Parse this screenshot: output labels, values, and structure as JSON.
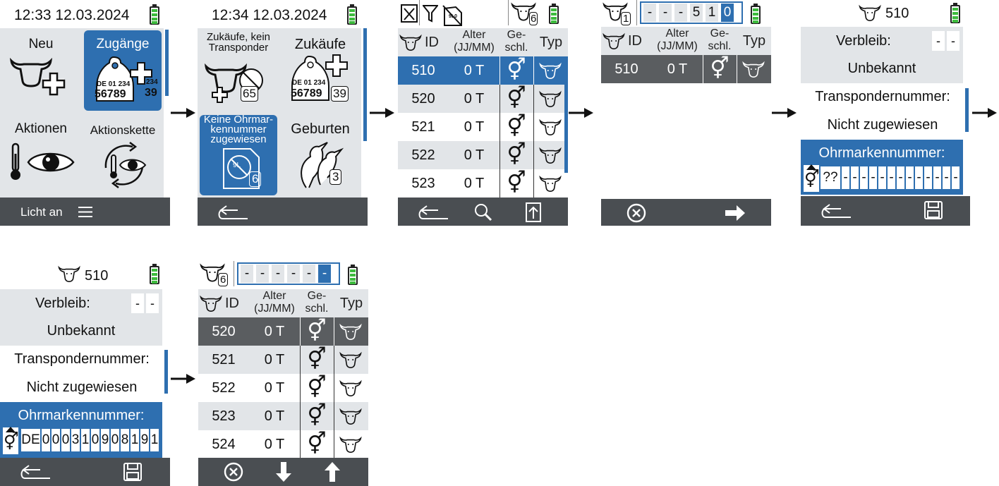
{
  "s1": {
    "datetime": "12:33 12.03.2024",
    "tiles": [
      {
        "label": "Neu",
        "icon": "cow-plus-icon"
      },
      {
        "label": "Zugänge",
        "icon": "eartag-plus-icon",
        "tag_line1": "DE 01 234",
        "tag_line2": "56789",
        "tag_side1": "234",
        "tag_side2": "39"
      },
      {
        "label": "Aktionen",
        "icon": "thermometer-eye-icon"
      },
      {
        "label": "Aktionskette",
        "icon": "action-cycle-icon"
      }
    ],
    "footer": {
      "label": "Licht an",
      "menu_icon": "hamburger-menu-icon"
    }
  },
  "s2": {
    "datetime": "12:34 12.03.2024",
    "tiles": [
      {
        "label": "Zukäufe, kein Transponder",
        "badge": "65"
      },
      {
        "label": "Zukäufe",
        "tag_line1": "DE 01 234",
        "tag_line2": "56789",
        "badge": "39"
      },
      {
        "label": "Keine Ohrmar-kennummer zugewiesen",
        "badge": "6",
        "tag_text": "9L"
      },
      {
        "label": "Geburten",
        "badge": "3"
      }
    ]
  },
  "s3": {
    "header_icons": [
      "animal-filter-icon",
      "filter-icon",
      "crossed-tag-icon"
    ],
    "herd_count": "6",
    "crossed_tag_text": "9L0",
    "columns": {
      "id": "ID",
      "age": "Alter",
      "age_unit": "(JJ/MM)",
      "sex_1": "Ge-",
      "sex_2": "schl.",
      "type": "Typ"
    },
    "rows": [
      {
        "id": "510",
        "age": "0 T",
        "sex": "⚥",
        "type": "cow-head"
      },
      {
        "id": "520",
        "age": "0 T",
        "sex": "⚥",
        "type": "cow-head"
      },
      {
        "id": "521",
        "age": "0 T",
        "sex": "⚥",
        "type": "cow-head"
      },
      {
        "id": "522",
        "age": "0 T",
        "sex": "⚥",
        "type": "cow-head"
      },
      {
        "id": "523",
        "age": "0 T",
        "sex": "⚥",
        "type": "cow-head"
      }
    ]
  },
  "s4": {
    "herd_count": "1",
    "digits": [
      "-",
      "-",
      "-",
      "5",
      "1",
      "0"
    ],
    "columns": {
      "id": "ID",
      "age": "Alter",
      "age_unit": "(JJ/MM)",
      "sex_1": "Ge-",
      "sex_2": "schl.",
      "type": "Typ"
    },
    "row": {
      "id": "510",
      "age": "0 T",
      "sex": "⚥"
    }
  },
  "s5": {
    "animal_id": "510",
    "verbleib_label": "Verbleib:",
    "verbleib_value": "Unbekannt",
    "verbleib_digits": [
      "-",
      "-"
    ],
    "transponder_label": "Transpondernummer:",
    "transponder_value": "Nicht zugewiesen",
    "ear_label": "Ohrmarkennummer:",
    "ear_value": [
      "??",
      "-",
      "-",
      "-",
      "-",
      "-",
      "-",
      "-",
      "-",
      "-",
      "-",
      "-",
      "-",
      "-"
    ],
    "sex": "⚥"
  },
  "s6": {
    "animal_id": "510",
    "verbleib_label": "Verbleib:",
    "verbleib_value": "Unbekannt",
    "verbleib_digits": [
      "-",
      "-"
    ],
    "transponder_label": "Transpondernummer:",
    "transponder_value": "Nicht zugewiesen",
    "ear_label": "Ohrmarkennummer:",
    "ear_value": [
      "DE",
      "0",
      "0",
      "0",
      "3",
      "1",
      "0",
      "9",
      "0",
      "8",
      "1",
      "9",
      "1"
    ],
    "sex": "⚥"
  },
  "s7": {
    "herd_count": "6",
    "digits": [
      "-",
      "-",
      "-",
      "-",
      "-",
      "-"
    ],
    "columns": {
      "id": "ID",
      "age": "Alter",
      "age_unit": "(JJ/MM)",
      "sex_1": "Ge-",
      "sex_2": "schl.",
      "type": "Typ"
    },
    "rows": [
      {
        "id": "520",
        "age": "0 T",
        "sex": "⚥"
      },
      {
        "id": "521",
        "age": "0 T",
        "sex": "⚥"
      },
      {
        "id": "522",
        "age": "0 T",
        "sex": "⚥"
      },
      {
        "id": "523",
        "age": "0 T",
        "sex": "⚥"
      },
      {
        "id": "524",
        "age": "0 T",
        "sex": "⚥"
      }
    ]
  },
  "colors": {
    "accent": "#2e6fb0",
    "footer": "#4a4e52",
    "panel": "#e2e5e8",
    "battery": "#3dbb3d"
  }
}
